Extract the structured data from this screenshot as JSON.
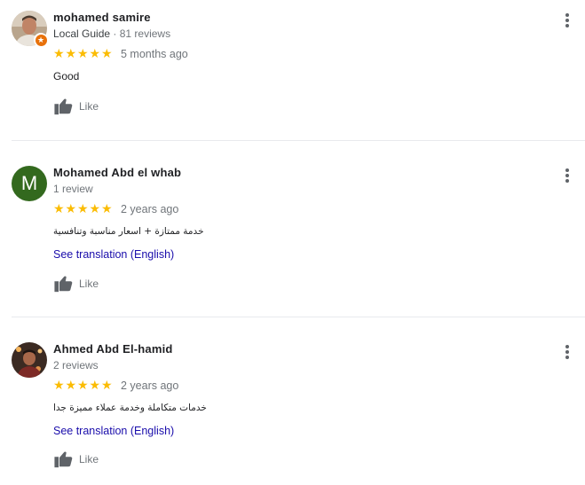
{
  "reviews": [
    {
      "name": "mohamed samire",
      "guide_label": "Local Guide",
      "reviews_count": "81 reviews",
      "rating": 5,
      "time": "5 months ago",
      "text": "Good",
      "like_label": "Like",
      "avatar_kind": "photo"
    },
    {
      "name": "Mohamed Abd el whab",
      "reviews_count": "1 review",
      "avatar_letter": "M",
      "avatar_color": "#33691e",
      "rating": 5,
      "time": "2 years ago",
      "text": "خدمة ممتازة + اسعار مناسبة وتنافسية",
      "translate_label": "See translation (English)",
      "like_label": "Like"
    },
    {
      "name": "Ahmed Abd El-hamid",
      "reviews_count": "2 reviews",
      "rating": 5,
      "time": "2 years ago",
      "text": "خدمات متكاملة وخدمة عملاء مميزة جدا",
      "translate_label": "See translation (English)",
      "like_label": "Like",
      "avatar_kind": "photo"
    }
  ],
  "colors": {
    "star": "#fbbc04",
    "link": "#1a0dab",
    "muted": "#70757a"
  }
}
